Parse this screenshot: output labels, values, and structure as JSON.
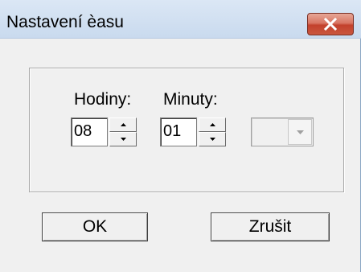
{
  "window": {
    "title": "Nastavení èasu",
    "close_icon": "close-icon",
    "colors": {
      "titlebar": "#c9daee",
      "close_button": "#c9573f",
      "background": "#f0f0f0"
    }
  },
  "form": {
    "hours_label": "Hodiny:",
    "hours_value": "08",
    "minutes_label": "Minuty:",
    "minutes_value": "01",
    "extra_select_value": ""
  },
  "buttons": {
    "ok_label": "OK",
    "cancel_label": "Zrušit"
  }
}
